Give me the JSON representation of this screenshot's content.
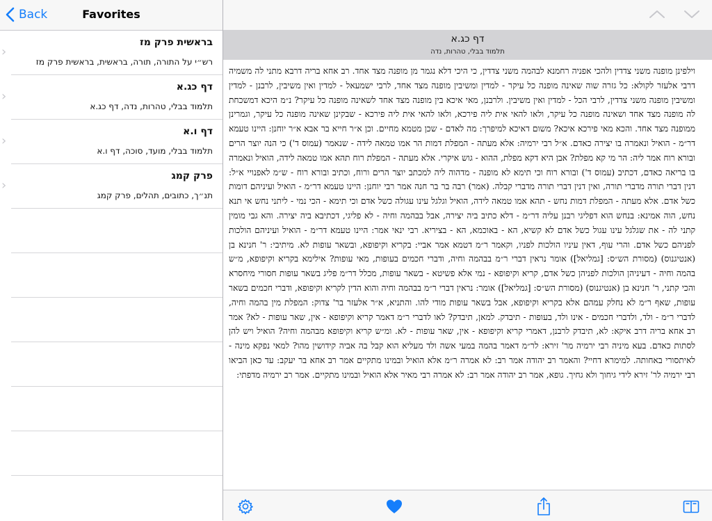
{
  "left_panel": {
    "back_label": "Back",
    "title": "Favorites",
    "items": [
      {
        "title": "בראשית פרק מז",
        "subtitle": "רש״י על התורה, תורה, בראשית, בראשית פרק מז"
      },
      {
        "title": "דף כג.א",
        "subtitle": "תלמוד בבלי, טהרות, נדה, דף כג.א"
      },
      {
        "title": "דף ו.א",
        "subtitle": "תלמוד בבלי, מועד, סוכה, דף ו.א"
      },
      {
        "title": "פרק קמג",
        "subtitle": "תנ״ך, כתובים, תהלים, פרק קמג"
      }
    ],
    "icons": {
      "back": "chevron-left-icon",
      "row": "chevron-right-icon"
    }
  },
  "right_panel": {
    "nav_icons": {
      "up": "chevron-up-icon",
      "down": "chevron-down-icon"
    },
    "page_title": "דף כג.א",
    "page_subtitle": "תלמוד בבלי, טהרות, נדה",
    "content": "וילפינן מופנה משני צדדין ולהכי אפניה רחמנא לבהמה משני צדדין, כי היכי דלא נגמר מן מופנה מצד אחד. רב אחא בריה דרבא מתני לה משמיה דרבי אלעזר לקולא: כל גזרה שוה שאינה מופנה כל עיקר - למדין ומשיבין מופנה מצד אחד, לרבי ישמעאל - למדין ואין משיבין, לרבנן - למדין ומשיבין מופנה משני צדדין, לרבי הכל - למדין ואין משיבין. ולרבנן, מאי איכא בין מופנה מצד אחד לשאינה מופנה כל עיקר? נ״מ היכא דמשכחת לה מופנה מצד אחד ושאינה מופנה כל עיקר, ולאו להאי אית ליה פירכא, ולאו להאי אית ליה פירכא - שבקינן שאינה מופנה כל עיקר, וגמרינן ממופנה מצד אחד. והכא מאי פירכא איכא? משום דאיכא למיפרך: מה לאדם - שכן מטמא מחיים. וכן א״ר חייא בר אבא א״ר יוחנן: היינו טעמא דר״מ - הואיל ונאמרה בו יצירה כאדם. א״ל רבי ירמיה: אלא מעתה - המפלת דמות הר אמו טמאה לידה - שנאמר (עמוס ד') כי הנה יוצר הרים ובורא רוח אמר ליה: הר מי קא מפלת? אבן היא דקא מפלת, ההוא - גוש איקרי. אלא מעתה - המפלת רוח תהא אמו טמאה לידה, הואיל ונאמרה בו בריאה כאדם, דכתיב (עמוס ד') ובורא רוח וכי תימא לא מופנה - מדהוה ליה למכתב יוצר הרים ורוח, וכתיב ובורא רוח - ש״מ לאפנויי א״ל: דנין דברי תורה מדברי תורה, ואין דנין דברי תורה מדברי קבלה. (אמר) רבה בר בר חנה אמר רבי יוחנן: היינו טעמא דר״מ - הואיל ועיניהם דומות כשל אדם. אלא מעתה - המפלת דמות נחש - תהא אמו טמאה לידה, הואיל וגלגל עינו עגולה כשל אדם וכי תימא - הכי נמי - ליתני נחש אי תנא נחש, הוה אמינא: בנחש הוא דפליגי רבנן עליה דר״מ - דלא כתיב ביה יצירה, אבל בבהמה וחיה - לא פליגי, דכתיבא ביה יצירה. והא גבי מומין קתני לה - את שגלגל עינו עגול כשל אדם לא קשיא, הא - באוכמא, הא - בציריא. רבי ינאי אמר: היינו טעמא דר״מ - הואיל ועיניהם הולכות לפניהם כשל אדם. והרי עוף, דאין עיניו הולכות לפניו, וקאמר ר״מ דטמא אמר אביי: בקריא וקיפופא, ובשאר עופות לא. מיתיבי: ר' חנינא בן (אנטיגנוס) (מסורת הש״ס: [גמליאל]) אומר נראין דברי ר״מ בבהמה וחיה, ודברי חכמים בעופות, מאי עופות? אילימא בקריא וקיפופא, מ״ש בהמה וחיה - דעיניהן הולכות לפניהן כשל אדם, קריא וקיפופא - נמי אלא פשיטא - בשאר עופות, מכלל דר״מ פליג בשאר עופות חסורי מיחסרא והכי קתני, ר' חנינא בן (אנטיגנוס) (מסורת הש״ס: [גמליאל]) אומר: נראין דברי ר״מ בבהמה וחיה והוא הדין לקריא וקיפופא, ודברי חכמים בשאר עופות, שאף ר״מ לא נחלק עמהם אלא בקריא וקיפופא, אבל בשאר עופות מודי להו. והתניא, א״ר אלעזר בר' צדוק: המפלת מין בהמה וחיה, לדברי ר״מ - ולד, ולדברי חכמים - אינו ולד, בעופות - תיבדק. למאן, תיבדק? לאו לדברי ר״מ דאמר קריא וקיפופא - אין, שאר עופות - לא? אמר רב אחא בריה דרב איקא: לא, תיבדק לרבנן, דאמרי קריא וקיפופא - אין, שאר עופות - לא. ומ״ש קריא וקיפופא מבהמה וחיה? הואיל ויש להן לסתות כאדם. בעא מיניה רבי ירמיה מר' זירא: לר״מ דאמר בהמה במעי אשה ולד מעליא הוא קבל בה אביה קידושין מהו? למאי נפקא מינה - לאיתסורי באחותה. למימרא דחיי? והאמר רב יהודה אמר רב: לא אמרה ר״מ אלא הואיל ובמינו מתקיים אמר רב אחא בר יעקב: עד כאן הביאו רבי ירמיה לר' זירא לידי גיחוך ולא גחיך. גופא, אמר רב יהודה אמר רב: לא אמרה רבי מאיר אלא הואיל ובמינו מתקיים. אמר רב ירמיה מדפתי:",
    "toolbar_icons": [
      "gear-icon",
      "heart-icon",
      "share-icon",
      "book-icon"
    ],
    "accent_color": "#157efb"
  }
}
